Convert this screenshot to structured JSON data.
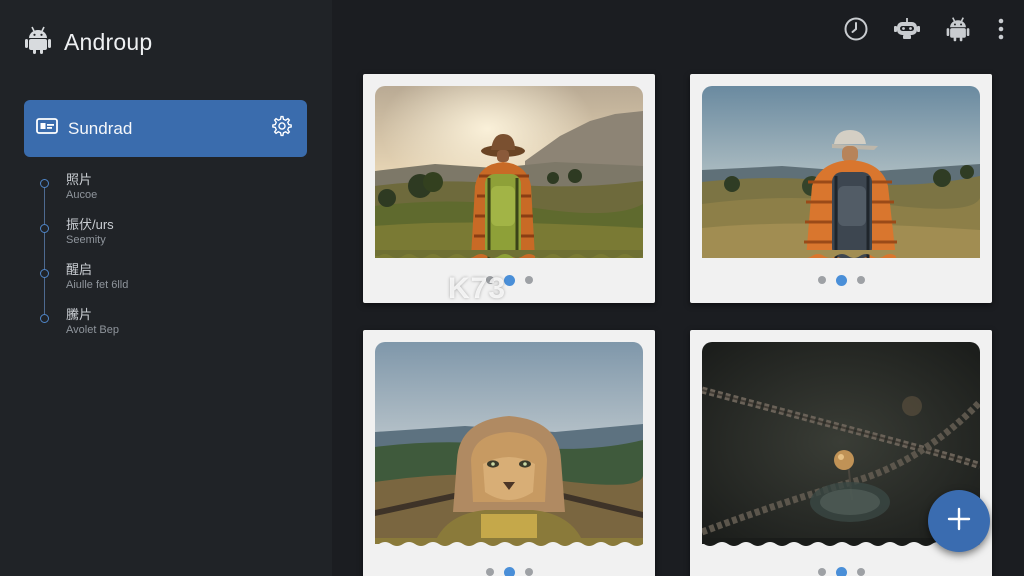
{
  "app": {
    "title": "Androup",
    "logo_icon": "android-icon"
  },
  "sidebar": {
    "selected": {
      "label": "Sundrad",
      "icon": "card-icon",
      "action_icon": "gear-icon"
    },
    "items": [
      {
        "title": "照片",
        "subtitle": "Aucoe"
      },
      {
        "title": "振伏/urs",
        "subtitle": "Seemity"
      },
      {
        "title": "醒启",
        "subtitle": "Aiulle fet 6lld"
      },
      {
        "title": "騰片",
        "subtitle": "Avolet Bep"
      }
    ]
  },
  "toolbar": {
    "icons": [
      "clock-icon",
      "robot-icon",
      "android-icon",
      "more-vert-icon"
    ]
  },
  "gallery": {
    "cards": [
      {
        "subject": "hiker-brown-hat",
        "dots": 3,
        "active": 1
      },
      {
        "subject": "hiker-cap",
        "dots": 3,
        "active": 1
      },
      {
        "subject": "lion-hoodie",
        "dots": 3,
        "active": 1
      },
      {
        "subject": "rope-close-up",
        "dots": 3,
        "active": 1
      }
    ]
  },
  "watermark": {
    "text": "K73"
  },
  "fab": {
    "icon": "plus-icon"
  },
  "colors": {
    "accent": "#3a6cad",
    "background": "#1b1d21",
    "sidebar": "#202327",
    "card": "#f1f1f1",
    "dot_active": "#4a8fd8"
  }
}
